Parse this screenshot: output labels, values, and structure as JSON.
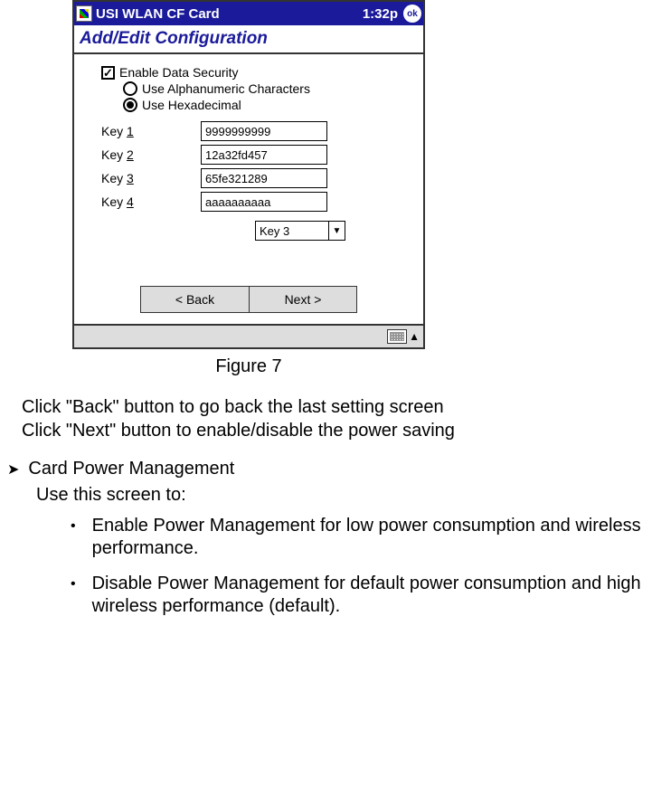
{
  "titlebar": {
    "app_title": "USI WLAN CF Card",
    "time": "1:32p",
    "ok_label": "ok"
  },
  "subheader": "Add/Edit Configuration",
  "security": {
    "enable_label": "Enable Data Security",
    "radio1": "Use Alphanumeric Characters",
    "radio2": "Use Hexadecimal"
  },
  "keys": [
    {
      "prefix": "Key ",
      "num": "1",
      "value": "9999999999"
    },
    {
      "prefix": "Key ",
      "num": "2",
      "value": "12a32fd457"
    },
    {
      "prefix": "Key ",
      "num": "3",
      "value": "65fe321289"
    },
    {
      "prefix": "Key ",
      "num": "4",
      "value": "aaaaaaaaaa"
    }
  ],
  "dropdown_selected": "Key 3",
  "buttons": {
    "back": "< Back",
    "next": "Next >"
  },
  "caption": "Figure 7",
  "instructions": {
    "line1": "Click \"Back\" button to go back the last setting screen",
    "line2": "Click \"Next\" button to enable/disable the power saving"
  },
  "section": {
    "heading": "Card Power Management",
    "intro": "Use this screen to:",
    "bullets": [
      "Enable Power Management for low power consumption and wireless performance.",
      "Disable Power Management for default power consumption and high wireless performance (default)."
    ]
  }
}
